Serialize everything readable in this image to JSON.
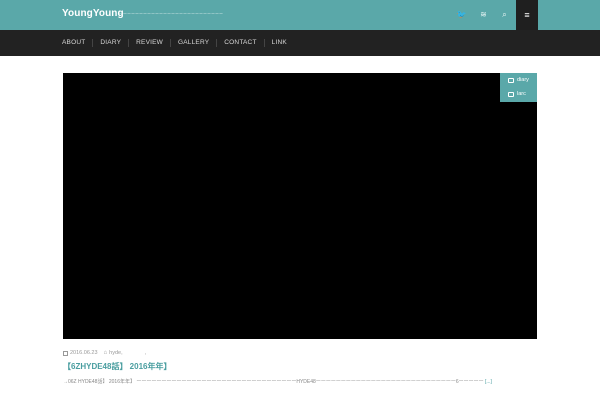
{
  "header": {
    "site_title": "YoungYoung",
    "tagline": "ーーーーーーーーーーーーーーーーーーーーーーーーーーーーーー",
    "icons": [
      "twitter-icon",
      "rss-icon",
      "search-icon",
      "menu-icon"
    ],
    "twitter_glyph": "🐦",
    "rss_glyph": "≋",
    "search_glyph": "⌕",
    "menu_glyph": "≡"
  },
  "nav": {
    "items": [
      "ABOUT",
      "DIARY",
      "REVIEW",
      "GALLERY",
      "CONTACT",
      "LINK"
    ]
  },
  "post": {
    "categories": [
      "diary",
      "larc"
    ],
    "date": "2016.06.23",
    "tag": "hyde,",
    "tag_extra": ",",
    "title": "【6ZHYDE48話】 2016年年】",
    "excerpt": "→06Z HYDE48話】 2016年年】 ーーーーーーーーーーーーーーーーーーーーーーーーーーーーーーーーHYDE48ーーーーーーーーーーーーーーーーーーーーーーーーーーーー6ーーーーー",
    "read_more": "[...]"
  },
  "colors": {
    "accent": "#5aa8a9",
    "nav_bg": "#222222",
    "media_bg": "#000000"
  }
}
